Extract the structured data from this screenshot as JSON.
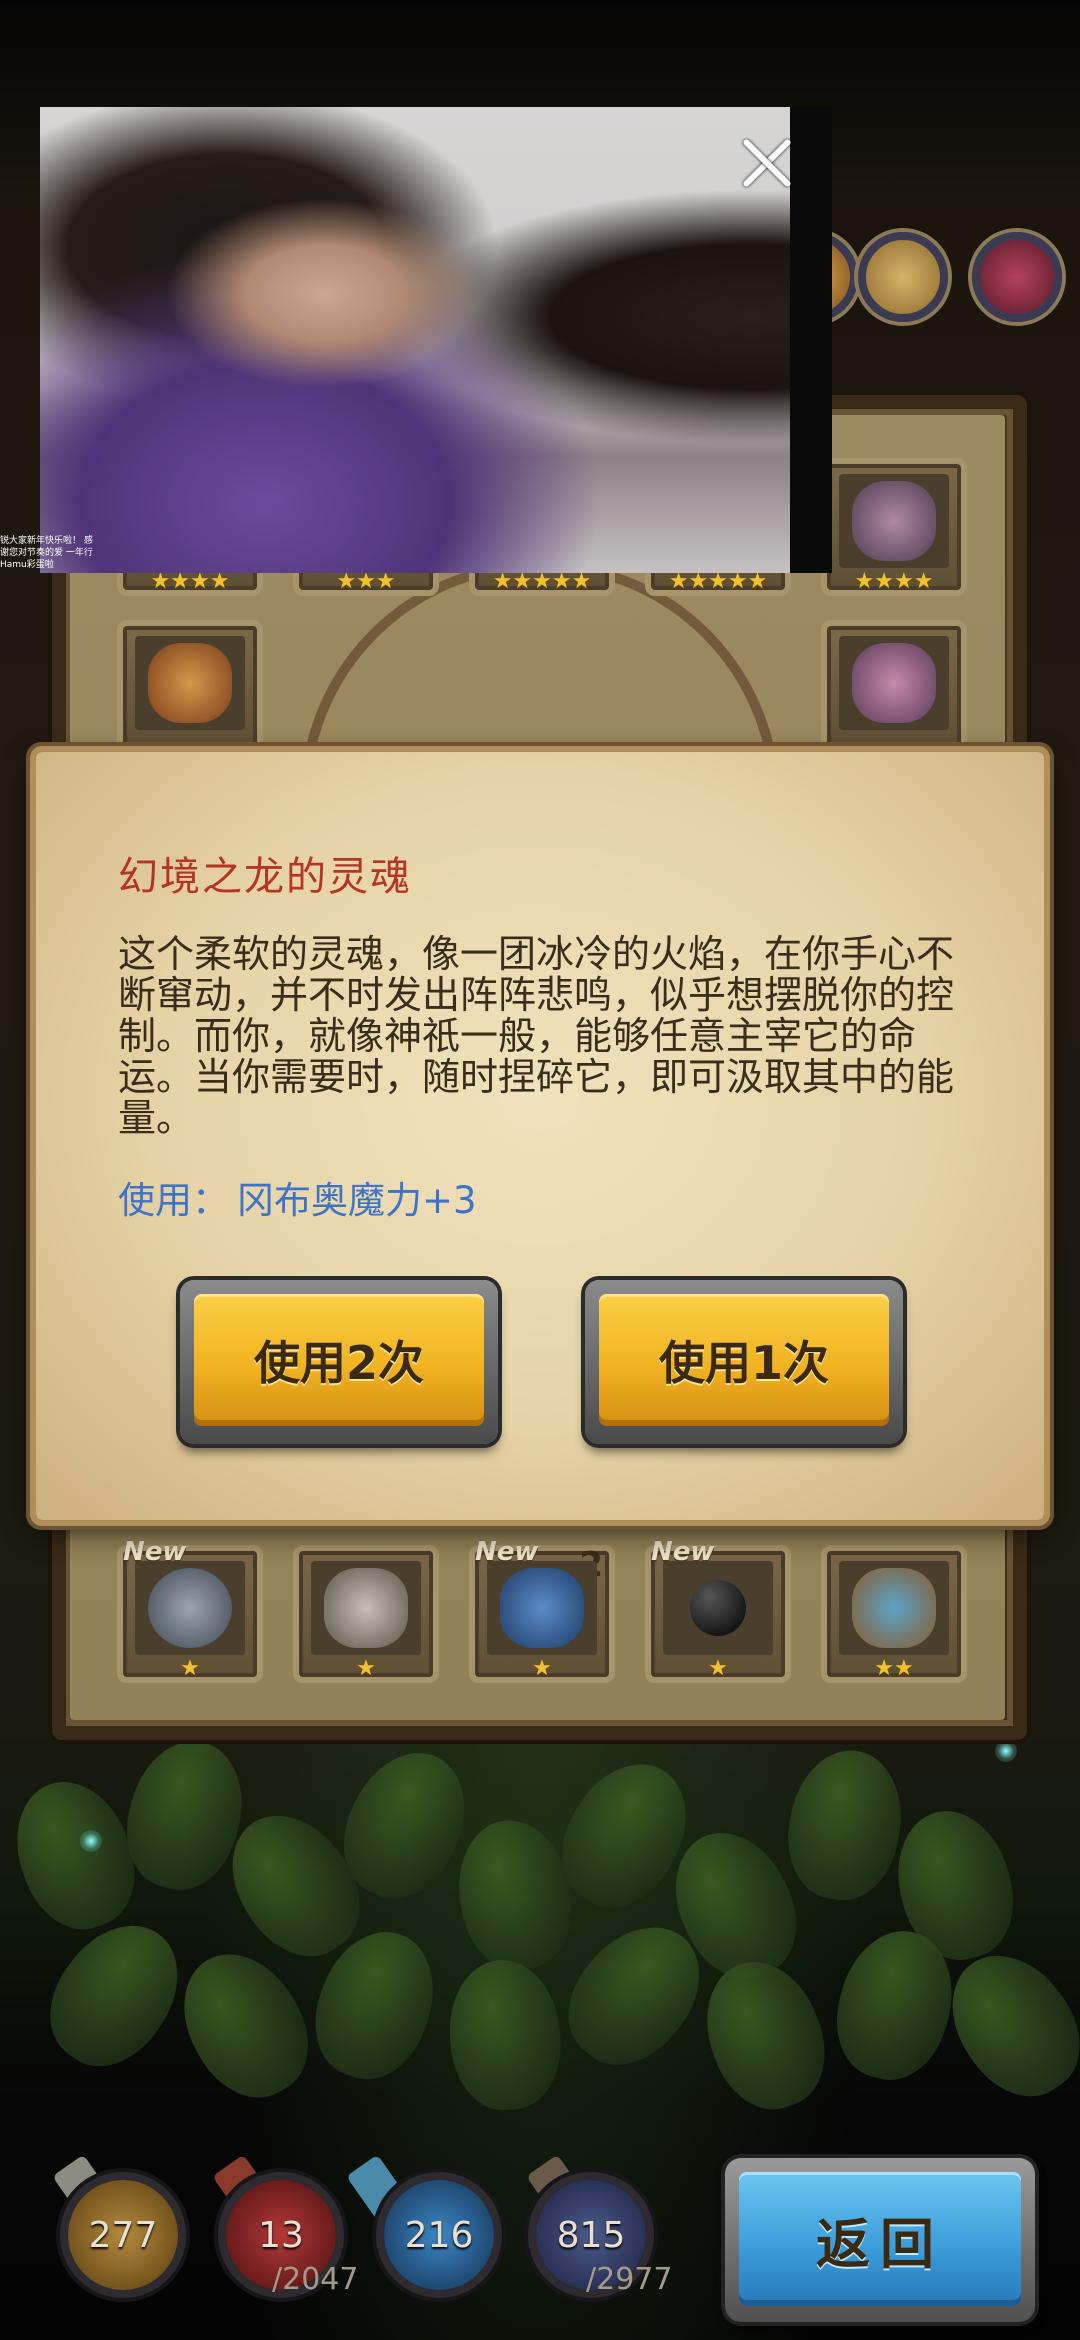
{
  "dialog": {
    "title": "幻境之龙的灵魂",
    "description": "这个柔软的灵魂，像一团冰冷的火焰，在你手心不断窜动，并不时发出阵阵悲鸣，似乎想摆脱你的控制。而你，就像神祇一般，能够任意主宰它的命运。当你需要时，随时捏碎它，即可汲取其中的能量。",
    "use_label": "使用：",
    "use_effect": "冈布奥魔力+3",
    "btn_use_twice": "使用2次",
    "btn_use_once": "使用1次"
  },
  "video": {
    "caption": "锐大家新年快乐啦！ 感谢您对节奏的爱 一年行 Hamu彩蛋啦"
  },
  "inventory": {
    "top_row_stars": [
      "★★★★",
      "★★★",
      "★★★★★",
      "★★★★★",
      "★★★★"
    ],
    "bottom_row": [
      {
        "new": "New",
        "stars": "★",
        "count": ""
      },
      {
        "new": "",
        "stars": "★",
        "count": ""
      },
      {
        "new": "New",
        "stars": "★",
        "count": "2"
      },
      {
        "new": "New",
        "stars": "★",
        "count": ""
      },
      {
        "new": "",
        "stars": "★★",
        "count": ""
      }
    ]
  },
  "hud": {
    "stats": [
      {
        "value": "277",
        "max": "",
        "color": "#b07a26"
      },
      {
        "value": "13",
        "max": "/2047",
        "color": "#9c2a2a"
      },
      {
        "value": "216",
        "max": "",
        "color": "#2f6fa8"
      },
      {
        "value": "815",
        "max": "/2977",
        "color": "#3a4a78"
      }
    ],
    "back_label": "返回"
  }
}
